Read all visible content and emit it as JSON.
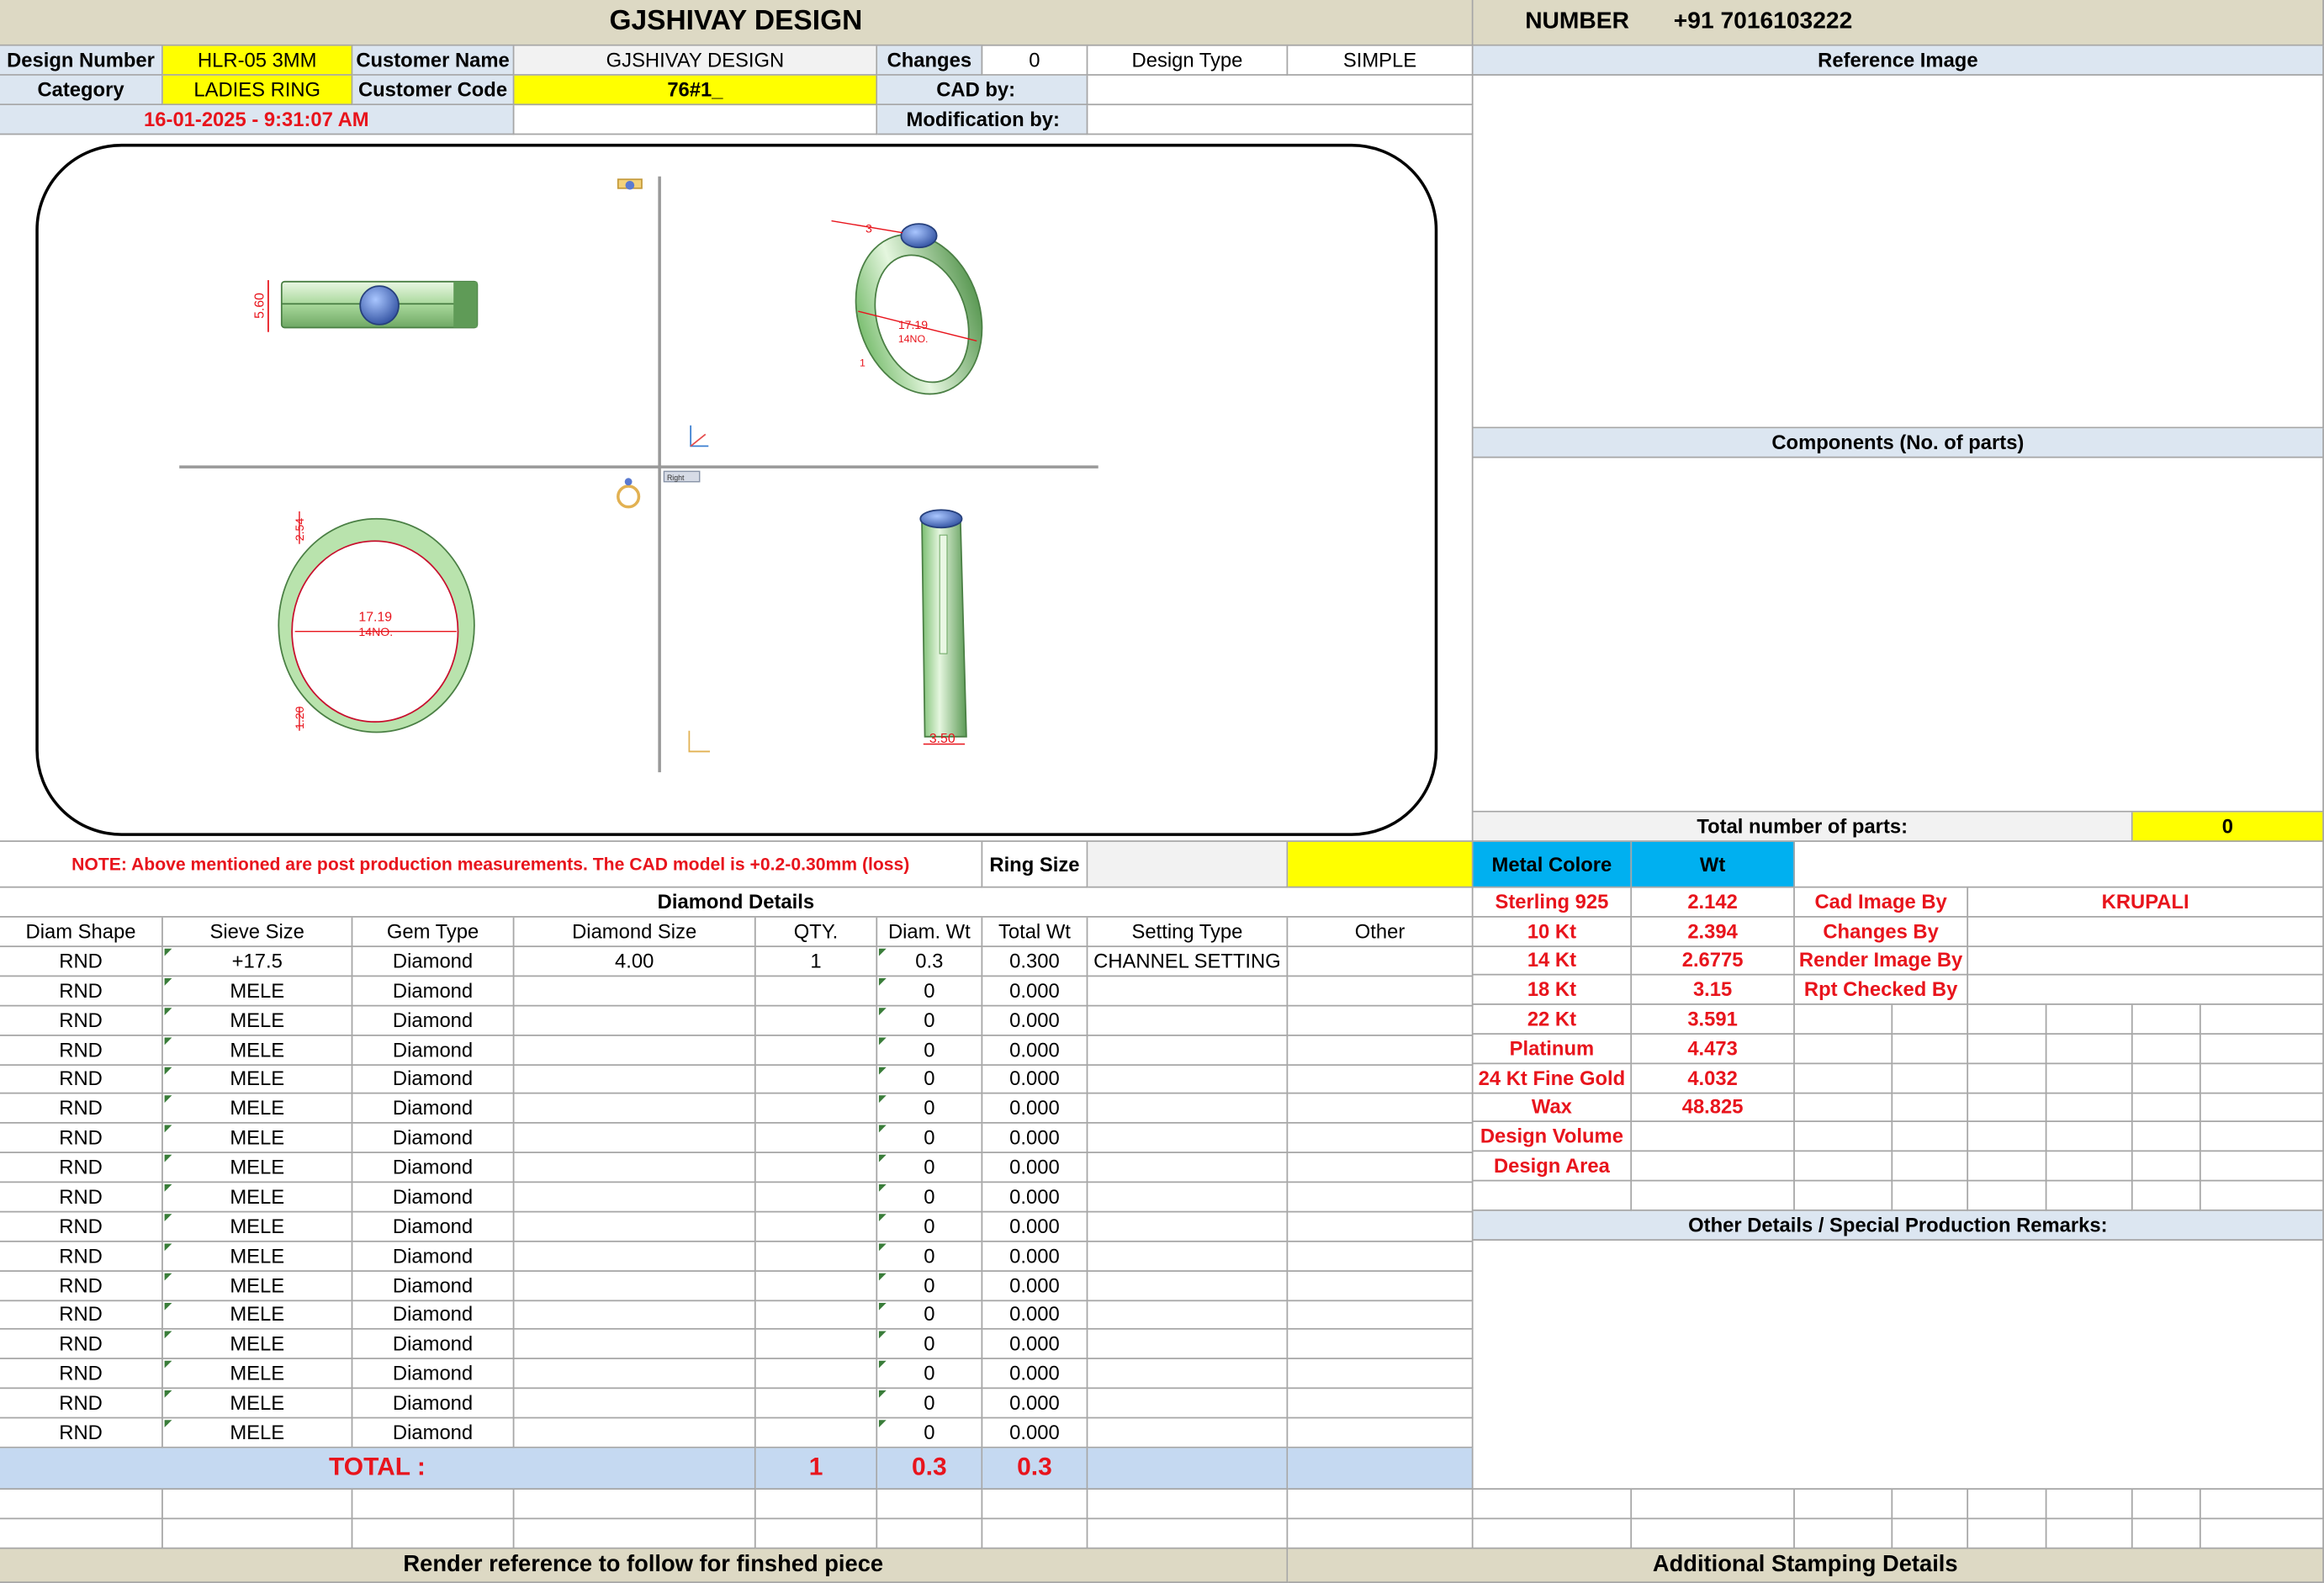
{
  "header": {
    "title": "GJSHIVAY DESIGN",
    "number_label": "NUMBER",
    "number_value": "+91 7016103222"
  },
  "info": {
    "design_number_label": "Design Number",
    "design_number": "HLR-05 3MM",
    "customer_name_label": "Customer Name",
    "customer_name": "GJSHIVAY DESIGN",
    "changes_label": "Changes",
    "changes": "0",
    "design_type_label": "Design Type",
    "design_type": "SIMPLE",
    "category_label": "Category",
    "category": "LADIES RING",
    "customer_code_label": "Customer Code",
    "customer_code": "76#1_",
    "cad_by_label": "CAD by:",
    "cad_by": "",
    "datetime": "16-01-2025 - 9:31:07 AM",
    "modification_label": "Modification by:",
    "modification_by": ""
  },
  "cad_drawing": {
    "top_height": "5.60",
    "iso_top": "3",
    "iso_diameter": "17.19",
    "iso_size": "14NO.",
    "iso_bottom": "1",
    "front_top_thickness": "2.54",
    "front_diameter": "17.19",
    "front_size": "14NO.",
    "front_bottom_thickness": "1.20",
    "side_width": "3.50",
    "view_label": "Right"
  },
  "note": {
    "text": "NOTE: Above mentioned are post production measurements. The CAD model is +0.2-0.30mm (loss)",
    "ring_size_label": "Ring Size",
    "ring_size": ""
  },
  "diamond": {
    "section_title": "Diamond Details",
    "columns": [
      "Diam Shape",
      "Sieve Size",
      "Gem Type",
      "Diamond Size",
      "QTY.",
      "Diam. Wt",
      "Total Wt",
      "Setting Type",
      "Other"
    ],
    "rows": [
      [
        "RND",
        "+17.5",
        "Diamond",
        "4.00",
        "1",
        "0.3",
        "0.300",
        "CHANNEL SETTING",
        ""
      ],
      [
        "RND",
        "MELE",
        "Diamond",
        "",
        "",
        "0",
        "0.000",
        "",
        ""
      ],
      [
        "RND",
        "MELE",
        "Diamond",
        "",
        "",
        "0",
        "0.000",
        "",
        ""
      ],
      [
        "RND",
        "MELE",
        "Diamond",
        "",
        "",
        "0",
        "0.000",
        "",
        ""
      ],
      [
        "RND",
        "MELE",
        "Diamond",
        "",
        "",
        "0",
        "0.000",
        "",
        ""
      ],
      [
        "RND",
        "MELE",
        "Diamond",
        "",
        "",
        "0",
        "0.000",
        "",
        ""
      ],
      [
        "RND",
        "MELE",
        "Diamond",
        "",
        "",
        "0",
        "0.000",
        "",
        ""
      ],
      [
        "RND",
        "MELE",
        "Diamond",
        "",
        "",
        "0",
        "0.000",
        "",
        ""
      ],
      [
        "RND",
        "MELE",
        "Diamond",
        "",
        "",
        "0",
        "0.000",
        "",
        ""
      ],
      [
        "RND",
        "MELE",
        "Diamond",
        "",
        "",
        "0",
        "0.000",
        "",
        ""
      ],
      [
        "RND",
        "MELE",
        "Diamond",
        "",
        "",
        "0",
        "0.000",
        "",
        ""
      ],
      [
        "RND",
        "MELE",
        "Diamond",
        "",
        "",
        "0",
        "0.000",
        "",
        ""
      ],
      [
        "RND",
        "MELE",
        "Diamond",
        "",
        "",
        "0",
        "0.000",
        "",
        ""
      ],
      [
        "RND",
        "MELE",
        "Diamond",
        "",
        "",
        "0",
        "0.000",
        "",
        ""
      ],
      [
        "RND",
        "MELE",
        "Diamond",
        "",
        "",
        "0",
        "0.000",
        "",
        ""
      ],
      [
        "RND",
        "MELE",
        "Diamond",
        "",
        "",
        "0",
        "0.000",
        "",
        ""
      ],
      [
        "RND",
        "MELE",
        "Diamond",
        "",
        "",
        "0",
        "0.000",
        "",
        ""
      ]
    ],
    "total_label": "TOTAL :",
    "total_qty": "1",
    "total_diam_wt": "0.3",
    "total_wt": "0.3"
  },
  "reference": {
    "title": "Reference Image",
    "components_title": "Components (No. of parts)",
    "total_parts_label": "Total number of parts:",
    "total_parts": "0"
  },
  "metal": {
    "color_label": "Metal Colore",
    "wt_label": "Wt",
    "rows": [
      {
        "name": "Sterling 925",
        "wt": "2.142"
      },
      {
        "name": "10 Kt",
        "wt": "2.394"
      },
      {
        "name": "14 Kt",
        "wt": "2.6775"
      },
      {
        "name": "18 Kt",
        "wt": "3.15"
      },
      {
        "name": "22 Kt",
        "wt": "3.591"
      },
      {
        "name": "Platinum",
        "wt": "4.473"
      },
      {
        "name": "24 Kt Fine Gold",
        "wt": "4.032"
      },
      {
        "name": "Wax",
        "wt": "48.825"
      },
      {
        "name": "Design Volume",
        "wt": ""
      },
      {
        "name": "Design Area",
        "wt": ""
      }
    ]
  },
  "credits": [
    {
      "label": "Cad Image By",
      "value": "KRUPALI"
    },
    {
      "label": "Changes By",
      "value": ""
    },
    {
      "label": "Render Image By",
      "value": ""
    },
    {
      "label": "Rpt Checked By",
      "value": ""
    }
  ],
  "remarks": {
    "title": "Other Details / Special Production Remarks:"
  },
  "footer": {
    "render_ref": "Render reference to follow for finshed piece",
    "stamping": "Additional Stamping Details"
  }
}
